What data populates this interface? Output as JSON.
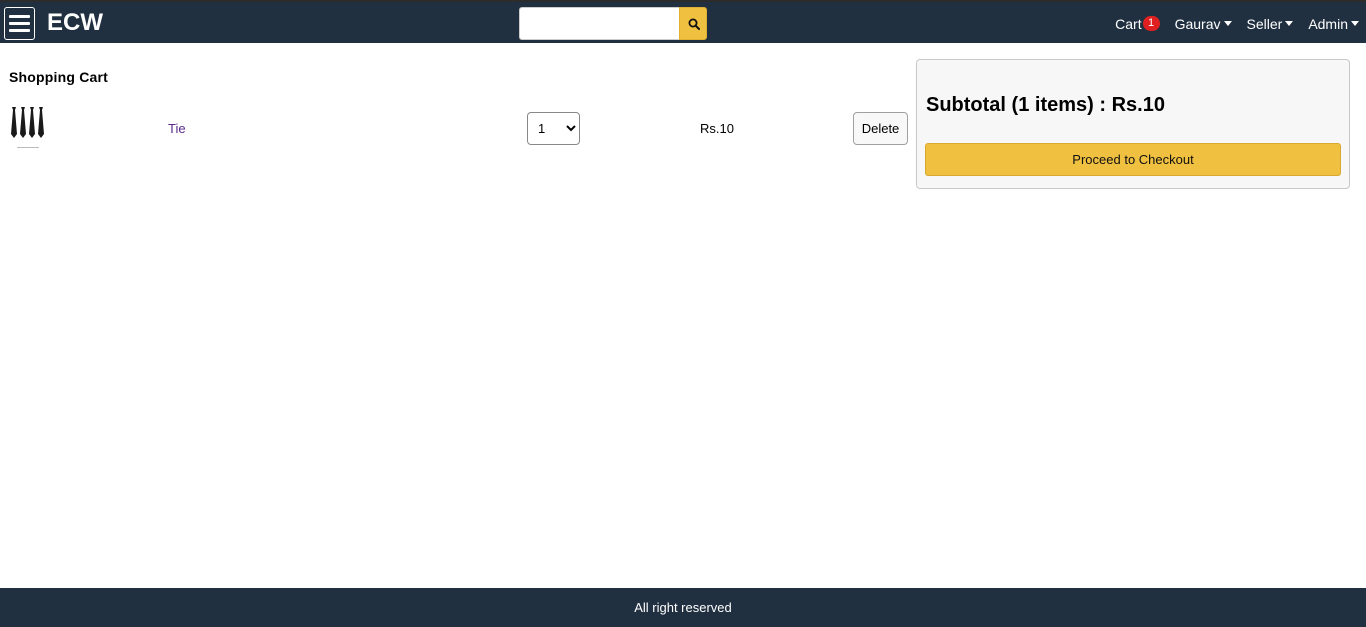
{
  "header": {
    "brand": "ECW",
    "search": {
      "value": "",
      "placeholder": ""
    },
    "nav": {
      "cart_label": "Cart",
      "cart_count": "1",
      "user_label": "Gaurav",
      "seller_label": "Seller",
      "admin_label": "Admin"
    }
  },
  "cart": {
    "title": "Shopping Cart",
    "items": [
      {
        "name": "Tie",
        "quantity": "1",
        "price": "Rs.10",
        "delete_label": "Delete",
        "image_icon": "tie-product-image"
      }
    ]
  },
  "summary": {
    "subtotal": "Subtotal (1 items) : Rs.10",
    "checkout_label": "Proceed to Checkout"
  },
  "footer": {
    "text": "All right reserved"
  },
  "colors": {
    "header_bg": "#203040",
    "accent": "#f0c040",
    "badge": "#e02020",
    "link": "#5b2a8a"
  }
}
